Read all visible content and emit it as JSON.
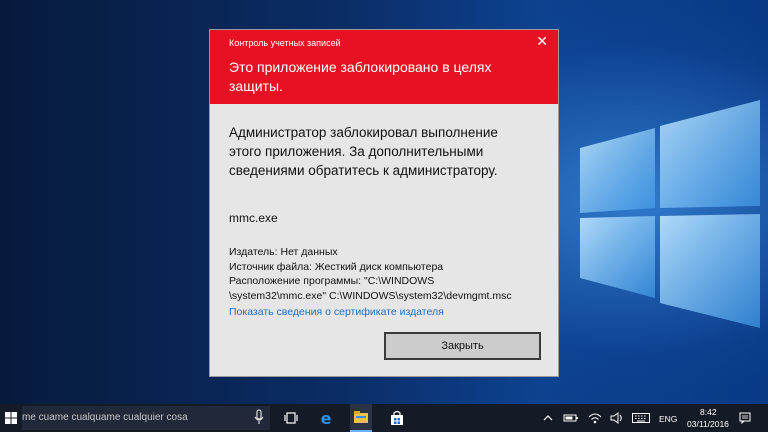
{
  "dialog": {
    "title": "Контроль учетных записей",
    "heading": "Это приложение заблокировано в целях защиты.",
    "message": "Администратор заблокировал выполнение этого приложения. За дополнительными сведениями обратитесь к администратору.",
    "app_name": "mmc.exe",
    "publisher": "Издатель: Нет данных",
    "source": "Источник файла: Жесткий диск компьютера",
    "location_line1": "Расположение программы: \"C:\\WINDOWS",
    "location_line2": "\\system32\\mmc.exe\" C:\\WINDOWS\\system32\\devmgmt.msc",
    "cert_link": "Показать сведения о сертификате издателя",
    "close_button": "Закрыть",
    "header_color": "#e81123"
  },
  "taskbar": {
    "search_text": "me cuame cualquame cualquier cosa",
    "language": "ENG",
    "time": "8:42",
    "date": "03/11/2016"
  },
  "icons": [
    "windows-start-icon",
    "microphone-icon",
    "task-view-icon",
    "edge-icon",
    "file-explorer-icon",
    "store-icon",
    "chevron-up-icon",
    "battery-icon",
    "wifi-icon",
    "speaker-icon",
    "keyboard-icon",
    "notification-icon"
  ]
}
